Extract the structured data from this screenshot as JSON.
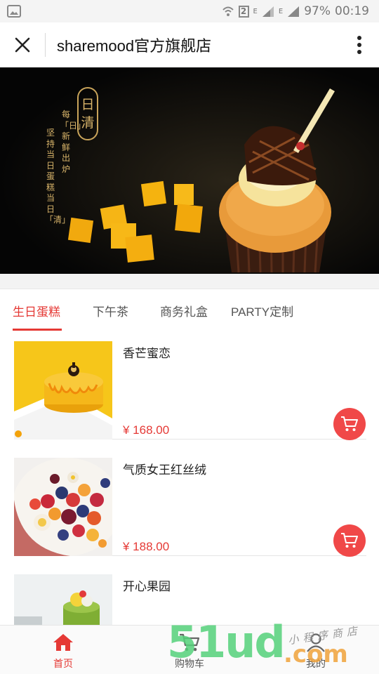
{
  "status_bar": {
    "sim_badge": "2",
    "network_label_1": "E",
    "network_label_2": "E",
    "battery": "97%",
    "time": "00:19"
  },
  "header": {
    "title": "sharemood官方旗舰店",
    "close_icon": "close-icon",
    "more_icon": "more-vertical-icon"
  },
  "banner": {
    "seal_text": "日清",
    "slogan_line_1": "每「日」新鲜出炉",
    "slogan_line_2": "坚持当日蛋糕当日「清」"
  },
  "tabs": [
    {
      "label": "生日蛋糕",
      "active": true
    },
    {
      "label": "下午茶",
      "active": false
    },
    {
      "label": "商务礼盒",
      "active": false
    },
    {
      "label": "PARTY定制",
      "active": false
    }
  ],
  "products": [
    {
      "name": "香芒蜜恋",
      "price": "¥ 168.00"
    },
    {
      "name": "气质女王红丝绒",
      "price": "¥ 188.00"
    },
    {
      "name": "开心果园",
      "price": ""
    }
  ],
  "tab_bar": [
    {
      "label": "首页",
      "icon": "home-icon",
      "active": true
    },
    {
      "label": "购物车",
      "icon": "cart-icon",
      "active": false
    },
    {
      "label": "我的",
      "icon": "user-icon",
      "active": false
    }
  ],
  "watermark": {
    "main": "51ud",
    "suffix": ".com",
    "sub": "小程序商店"
  },
  "colors": {
    "accent": "#e53935",
    "cart_button": "#f04848",
    "banner_gold": "#d8b46a"
  }
}
